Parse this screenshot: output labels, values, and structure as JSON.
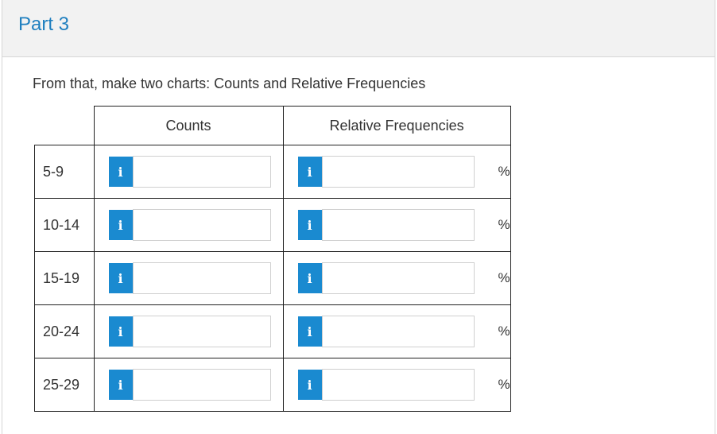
{
  "header": {
    "title": "Part 3"
  },
  "instruction": "From that, make two charts: Counts and Relative Frequencies",
  "table": {
    "columns": [
      "Counts",
      "Relative Frequencies"
    ],
    "rows": [
      {
        "label": "5-9",
        "count_value": "",
        "freq_value": "",
        "unit": "%"
      },
      {
        "label": "10-14",
        "count_value": "",
        "freq_value": "",
        "unit": "%"
      },
      {
        "label": "15-19",
        "count_value": "",
        "freq_value": "",
        "unit": "%"
      },
      {
        "label": "20-24",
        "count_value": "",
        "freq_value": "",
        "unit": "%"
      },
      {
        "label": "25-29",
        "count_value": "",
        "freq_value": "",
        "unit": "%"
      }
    ]
  },
  "icons": {
    "info": "i"
  },
  "colors": {
    "accent": "#1a8ad0",
    "title": "#1f7fbf"
  }
}
